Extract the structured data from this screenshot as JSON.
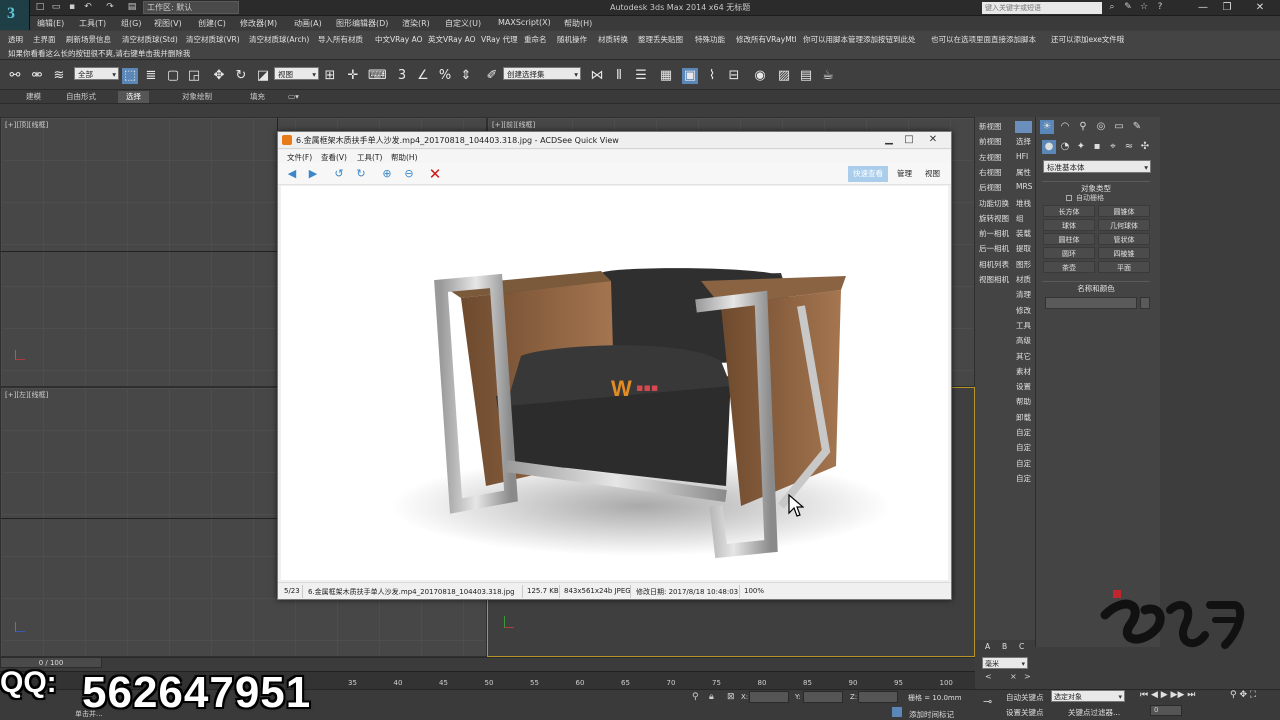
{
  "app": {
    "title": "Autodesk 3ds Max  2014 x64     无标题",
    "workspace": "工作区: 默认",
    "search_placeholder": "键入关键字或短语"
  },
  "menubar": [
    "编辑(E)",
    "工具(T)",
    "组(G)",
    "视图(V)",
    "创建(C)",
    "修改器(M)",
    "动画(A)",
    "图形编辑器(D)",
    "渲染(R)",
    "自定义(U)",
    "MAXScript(X)",
    "帮助(H)"
  ],
  "scriptbar": {
    "buttons": [
      "透明",
      "主界面",
      "刷新场景信息",
      "清空材质球(Std)",
      "清空材质球(VR)",
      "清空材质球(Arch)",
      "导入所有材质",
      "中文VRay AO",
      "英文VRay AO",
      "VRay 代理",
      "重命名",
      "随机操作",
      "材质转换",
      "整理丢失贴图",
      "特殊功能",
      "修改所有VRayMtl",
      "你可以用脚本管理添加按钮到此处",
      "也可以在选项里面直接添加脚本",
      "还可以添加exe文件哦"
    ],
    "note": "如果你看看这么长的按钮很不爽,请右键单击我并删除我"
  },
  "maintool": {
    "filter": "全部",
    "refcoord": "视图",
    "selset": "创建选择集",
    "snap_num": "3"
  },
  "ribbon": [
    "建模",
    "自由形式",
    "选择",
    "对象绘制",
    "填充"
  ],
  "viewports": {
    "top_left": "[+][顶][线框]",
    "bottom_left": "[+][左][线框]",
    "persp": "[+][前][线框]"
  },
  "cmdlist": [
    {
      "a": "新视图",
      "b": ""
    },
    {
      "a": "前视图",
      "b": "选择"
    },
    {
      "a": "左视图",
      "b": "HFI"
    },
    {
      "a": "右视图",
      "b": "属性"
    },
    {
      "a": "后视图",
      "b": "MRS"
    },
    {
      "a": "功能切换",
      "b": "堆栈"
    },
    {
      "a": "旋转视图",
      "b": "组"
    },
    {
      "a": "前一相机",
      "b": "装载"
    },
    {
      "a": "后一相机",
      "b": "提取"
    },
    {
      "a": "相机列表",
      "b": "图形"
    },
    {
      "a": "视图相机",
      "b": "材质"
    },
    {
      "a": "",
      "b": "清理"
    },
    {
      "a": "",
      "b": "修改"
    },
    {
      "a": "",
      "b": "工具"
    },
    {
      "a": "",
      "b": "高级"
    },
    {
      "a": "",
      "b": "其它"
    },
    {
      "a": "",
      "b": "素材"
    },
    {
      "a": "",
      "b": "设置"
    },
    {
      "a": "",
      "b": "帮助"
    },
    {
      "a": "",
      "b": "卸载"
    },
    {
      "a": "",
      "b": "自定"
    },
    {
      "a": "",
      "b": "自定"
    },
    {
      "a": "",
      "b": "自定"
    },
    {
      "a": "",
      "b": "自定"
    }
  ],
  "cmdpanel": {
    "category": "标准基本体",
    "section_object_type": "对象类型",
    "autogrid": "自动栅格",
    "buttons": [
      "长方体",
      "圆锥体",
      "球体",
      "几何球体",
      "圆柱体",
      "管状体",
      "圆环",
      "四棱锥",
      "茶壶",
      "平面"
    ],
    "section_name_color": "名称和颜色"
  },
  "acdsee": {
    "title": "6.金属框架木质扶手单人沙发.mp4_20170818_104403.318.jpg - ACDSee Quick View",
    "menu": [
      "文件(F)",
      "查看(V)",
      "工具(T)",
      "帮助(H)"
    ],
    "modes": [
      "快速查看",
      "管理",
      "视图"
    ],
    "status": {
      "index": "5/23",
      "filename": "6.金属框架木质扶手单人沙发.mp4_20170818_104403.318.jpg",
      "size": "125.7 KB",
      "dims": "843x561x24b JPEG",
      "modified": "修改日期: 2017/8/18 10:48:03",
      "zoom": "100%"
    }
  },
  "timeline": {
    "frame": "0 / 100",
    "ticks": [
      "35",
      "40",
      "45",
      "50",
      "55",
      "60",
      "65",
      "70",
      "75",
      "80",
      "85",
      "90",
      "95",
      "100"
    ]
  },
  "status": {
    "grid": "栅格 = 10.0mm",
    "add_time_tag": "添加时间标记",
    "auto_key": "自动关键点",
    "set_key": "设置关键点",
    "key_filter": "关键点过滤器...",
    "selected": "选定对象",
    "unit": "毫米",
    "frame_val": "0",
    "left_msg": "单击并...",
    "abc": [
      "A",
      "B",
      "C"
    ]
  },
  "overlay": {
    "label": "QQ:",
    "number": "562647951"
  }
}
